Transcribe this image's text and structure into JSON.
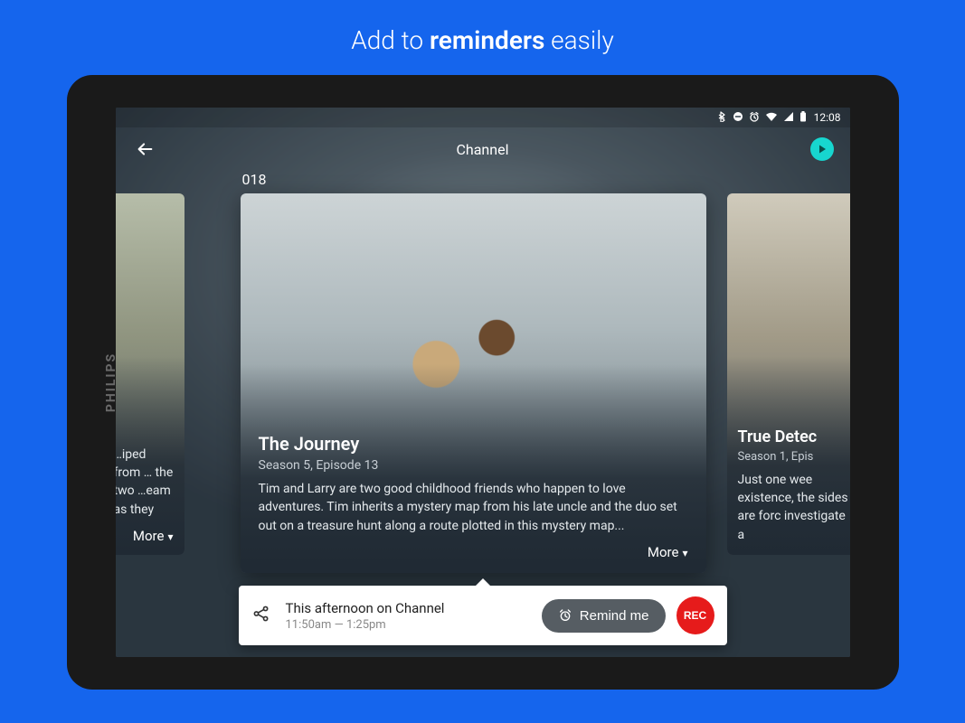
{
  "banner": {
    "pre": "Add to ",
    "bold": "reminders",
    "post": " easily"
  },
  "device_brand": "PHILIPS",
  "statusbar": {
    "time": "12:08"
  },
  "nav": {
    "title": "Channel",
    "channel_number": "018"
  },
  "cards": {
    "left": {
      "desc": "…iped from … the two …eam as they",
      "more": "More"
    },
    "center": {
      "title": "The Journey",
      "subtitle": "Season 5, Episode 13",
      "desc": "Tim and Larry are two good childhood friends who happen to love adventures. Tim inherits a mystery map from his late uncle and the duo set out on a treasure hunt along a route plotted in this mystery map...",
      "more": "More"
    },
    "right": {
      "title": "True Detec",
      "subtitle": "Season 1, Epis",
      "desc": "Just one wee existence, the sides are forc investigate a"
    }
  },
  "actionbar": {
    "schedule_title": "This afternoon on Channel",
    "schedule_time": "11:50am — 1:25pm",
    "remind_label": "Remind me",
    "rec_label": "REC"
  }
}
